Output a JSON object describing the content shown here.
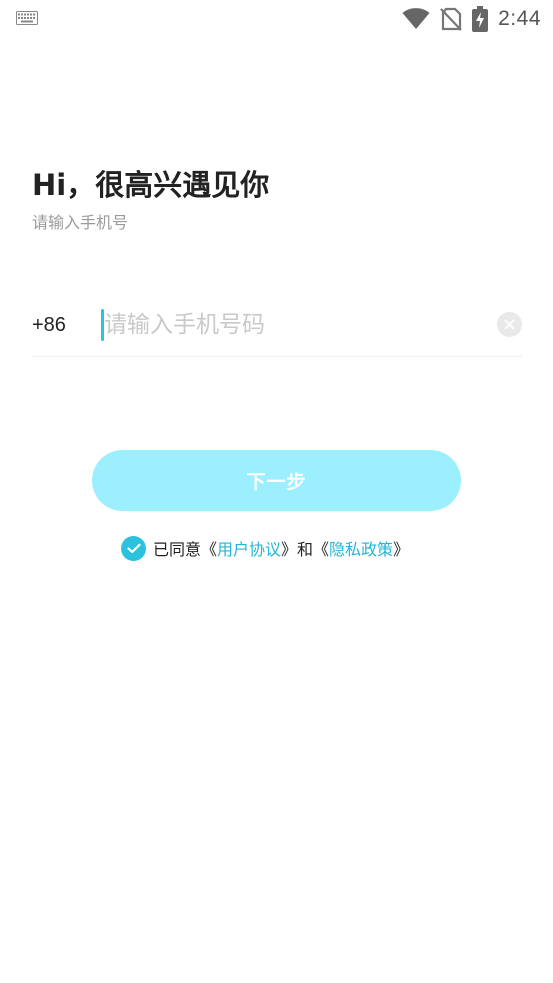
{
  "status_bar": {
    "time": "2:44",
    "icons": [
      "keyboard-icon",
      "wifi-icon",
      "no-sim-icon",
      "battery-charging-icon"
    ]
  },
  "greeting": {
    "title": "Hi，很高兴遇见你",
    "subtitle": "请输入手机号"
  },
  "phone_form": {
    "country_code": "+86",
    "value": "",
    "placeholder": "请输入手机号码",
    "clear_icon": "close-icon"
  },
  "next_button": {
    "label": "下一步"
  },
  "agreement": {
    "checked": true,
    "prefix": "已同意《",
    "user_agreement": "用户协议",
    "middle": "》和《",
    "privacy_policy": "隐私政策",
    "suffix": "》"
  },
  "colors": {
    "accent": "#2ac2dd",
    "button_bg": "#9befff",
    "link": "#22b6d6",
    "placeholder": "#c9c9c9"
  }
}
